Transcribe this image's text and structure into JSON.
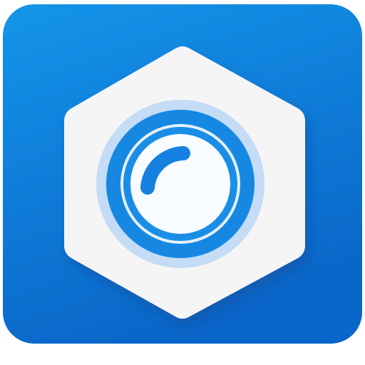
{
  "app_icon": {
    "icon_name": "camera-lens-icon",
    "shape": "rounded-square",
    "inner_shape": "hexagon",
    "colors": {
      "background_top": "#1495ea",
      "background_bottom": "#0a66c8",
      "hexagon_fill": "#f5f5f6",
      "hexagon_shadow": "#0b4f9f",
      "lens_outer_glow": "#c4dcf5",
      "lens_ring": "#1688e2",
      "lens_gap": "#e6f1fb",
      "lens_inner_ring": "#1a8ee6",
      "lens_center": "#f8fbff",
      "lens_highlight": "#1580df"
    }
  }
}
